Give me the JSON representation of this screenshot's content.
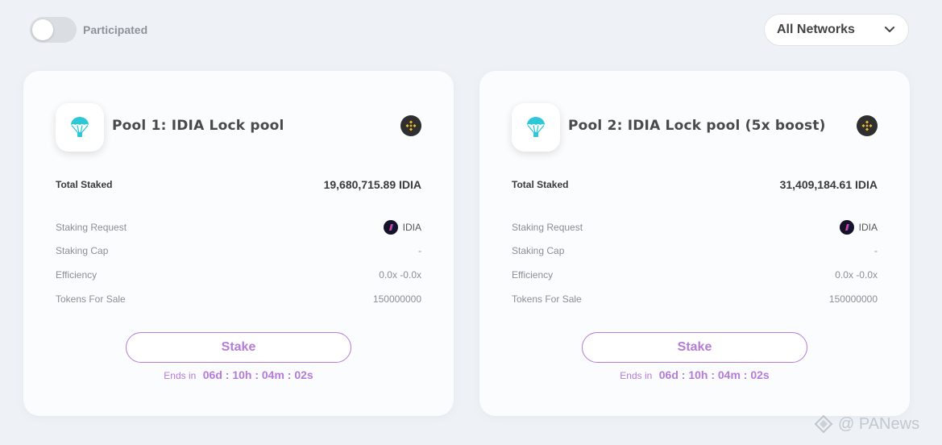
{
  "filter": {
    "participated_label": "Participated",
    "participated_on": false,
    "network_select_value": "All Networks"
  },
  "pools": [
    {
      "title": "Pool 1: IDIA Lock pool",
      "total_staked_label": "Total Staked",
      "total_staked_value": "19,680,715.89 IDIA",
      "staking_request_label": "Staking Request",
      "staking_request_value": "IDIA",
      "staking_cap_label": "Staking Cap",
      "staking_cap_value": "-",
      "efficiency_label": "Efficiency",
      "efficiency_value": "0.0x -0.0x",
      "tokens_for_sale_label": "Tokens For Sale",
      "tokens_for_sale_value": "150000000",
      "stake_button": "Stake",
      "ends_label": "Ends in",
      "ends_time": "06d : 10h : 04m : 02s"
    },
    {
      "title": "Pool 2: IDIA Lock pool (5x boost)",
      "total_staked_label": "Total Staked",
      "total_staked_value": "31,409,184.61 IDIA",
      "staking_request_label": "Staking Request",
      "staking_request_value": "IDIA",
      "staking_cap_label": "Staking Cap",
      "staking_cap_value": "-",
      "efficiency_label": "Efficiency",
      "efficiency_value": "0.0x -0.0x",
      "tokens_for_sale_label": "Tokens For Sale",
      "tokens_for_sale_value": "150000000",
      "stake_button": "Stake",
      "ends_label": "Ends in",
      "ends_time": "06d : 10h : 04m : 02s"
    }
  ],
  "icons": {
    "pool": "parachute-icon",
    "chain": "bnb-chain-icon",
    "token": "idia-token-icon",
    "dropdown": "chevron-down-icon"
  },
  "colors": {
    "background": "#eef2f6",
    "card": "#fbfcfd",
    "accent": "#b57bd9",
    "parachute": "#2ec7d6",
    "bnb": "#f3ba2f"
  },
  "watermark": {
    "text": "@ PANews"
  }
}
